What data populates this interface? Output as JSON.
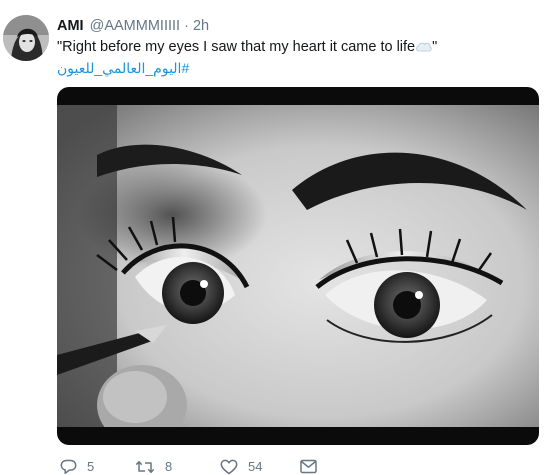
{
  "tweet": {
    "display_name": "AMI",
    "handle": "@AAMMMIIIII",
    "separator": "·",
    "time": "2h",
    "text": "\"Right before my eyes I saw that my heart it came to life",
    "text_end": "\"",
    "emoji_icon": "cloud-icon",
    "hashtag": "#اليوم_العالمي_للعيون",
    "media_description_icon": "photo"
  },
  "actions": {
    "reply_count": "5",
    "retweet_count": "8",
    "like_count": "54",
    "icons": [
      "reply-icon",
      "retweet-icon",
      "like-icon",
      "direct-message-icon"
    ]
  },
  "colors": {
    "link": "#1b95e0",
    "muted": "#657786",
    "text": "#14171a"
  }
}
